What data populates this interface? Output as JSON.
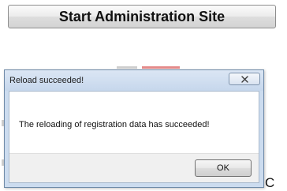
{
  "start_button_label": "Start Administration Site",
  "dialog": {
    "title": "Reload succeeded!",
    "message": "The reloading of registration data has succeeded!",
    "ok_label": "OK",
    "close_icon": "close-icon"
  },
  "background_fragment": "C"
}
